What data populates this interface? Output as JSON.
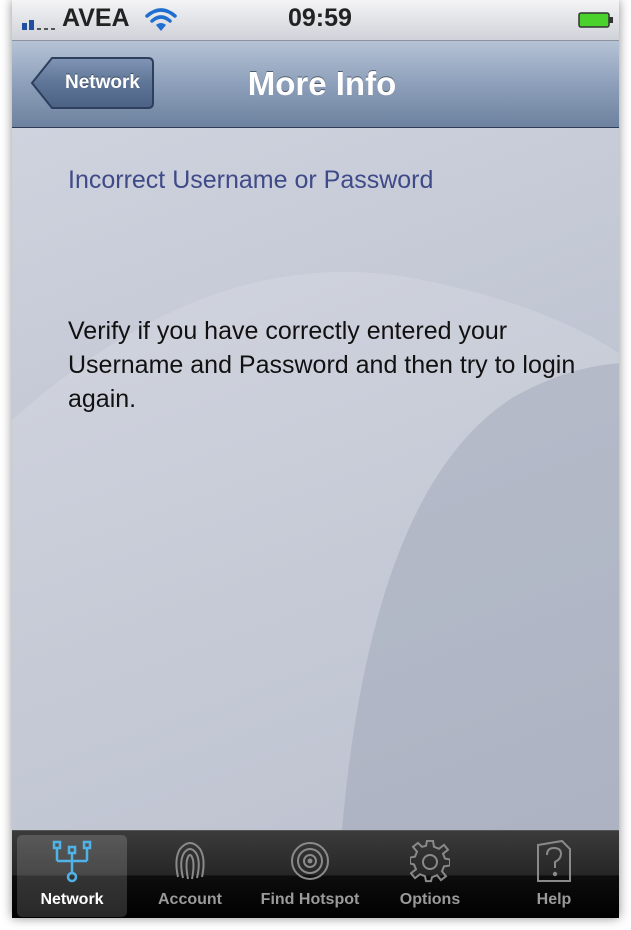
{
  "status_bar": {
    "carrier": "AVEA",
    "time": "09:59"
  },
  "nav_bar": {
    "back_label": "Network",
    "title": "More Info"
  },
  "content": {
    "heading": "Incorrect Username or Password",
    "message": "Verify if you have correctly entered your Username and Password and then try to login again."
  },
  "tab_bar": {
    "tabs": [
      {
        "label": "Network",
        "icon": "network-icon",
        "selected": true
      },
      {
        "label": "Account",
        "icon": "fingerprint-icon",
        "selected": false
      },
      {
        "label": "Find Hotspot",
        "icon": "hotspot-icon",
        "selected": false
      },
      {
        "label": "Options",
        "icon": "gear-icon",
        "selected": false
      },
      {
        "label": "Help",
        "icon": "help-icon",
        "selected": false
      }
    ]
  },
  "colors": {
    "heading_text": "#3f4a88",
    "nav_bar": "#8d9fba",
    "tab_bar": "#1a1a1a",
    "selected_tab_icon": "#4fb3e8"
  }
}
